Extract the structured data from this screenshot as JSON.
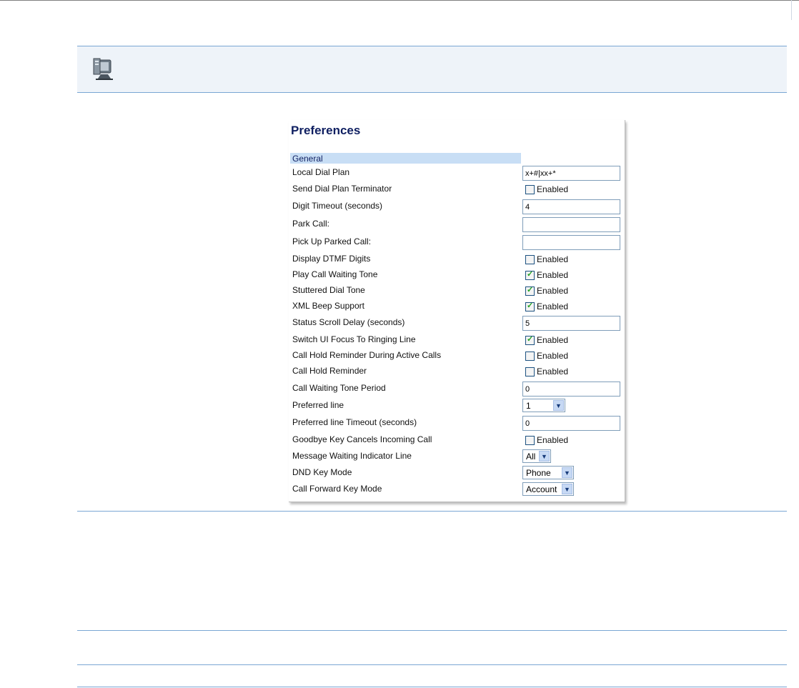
{
  "panel": {
    "title": "Preferences",
    "section": "General"
  },
  "rows": [
    {
      "label": "Local Dial Plan",
      "type": "text",
      "value": "x+#|xx+*"
    },
    {
      "label": "Send Dial Plan Terminator",
      "type": "checkbox",
      "checked": false,
      "text": "Enabled"
    },
    {
      "label": "Digit Timeout (seconds)",
      "type": "text",
      "value": "4"
    },
    {
      "label": "Park Call:",
      "type": "text",
      "value": ""
    },
    {
      "label": "Pick Up Parked Call:",
      "type": "text",
      "value": ""
    },
    {
      "label": "Display DTMF Digits",
      "type": "checkbox",
      "checked": false,
      "text": "Enabled"
    },
    {
      "label": "Play Call Waiting Tone",
      "type": "checkbox",
      "checked": true,
      "text": "Enabled"
    },
    {
      "label": "Stuttered Dial Tone",
      "type": "checkbox",
      "checked": true,
      "text": "Enabled"
    },
    {
      "label": "XML Beep Support",
      "type": "checkbox",
      "checked": true,
      "text": "Enabled"
    },
    {
      "label": "Status Scroll Delay (seconds)",
      "type": "text",
      "value": "5"
    },
    {
      "label": "Switch UI Focus To Ringing Line",
      "type": "checkbox",
      "checked": true,
      "text": "Enabled"
    },
    {
      "label": "Call Hold Reminder During Active Calls",
      "type": "checkbox",
      "checked": false,
      "text": "Enabled"
    },
    {
      "label": "Call Hold Reminder",
      "type": "checkbox",
      "checked": false,
      "text": "Enabled"
    },
    {
      "label": "Call Waiting Tone Period",
      "type": "text",
      "value": "0"
    },
    {
      "label": "Preferred line",
      "type": "select",
      "value": "1"
    },
    {
      "label": "Preferred line Timeout (seconds)",
      "type": "text",
      "value": "0"
    },
    {
      "label": "Goodbye Key Cancels Incoming Call",
      "type": "checkbox",
      "checked": false,
      "text": "Enabled"
    },
    {
      "label": "Message Waiting Indicator Line",
      "type": "select",
      "value": "All"
    },
    {
      "label": "DND Key Mode",
      "type": "select",
      "value": "Phone"
    },
    {
      "label": "Call Forward Key Mode",
      "type": "select",
      "value": "Account"
    }
  ],
  "icons": {
    "header": "computer-monitor-icon",
    "dropdown": "chevron-down-icon",
    "check": "checkmark-icon"
  },
  "colors": {
    "title": "#0f1f61",
    "section_bg": "#c8def5",
    "rule": "#7aa6d4",
    "check": "#21a121"
  }
}
